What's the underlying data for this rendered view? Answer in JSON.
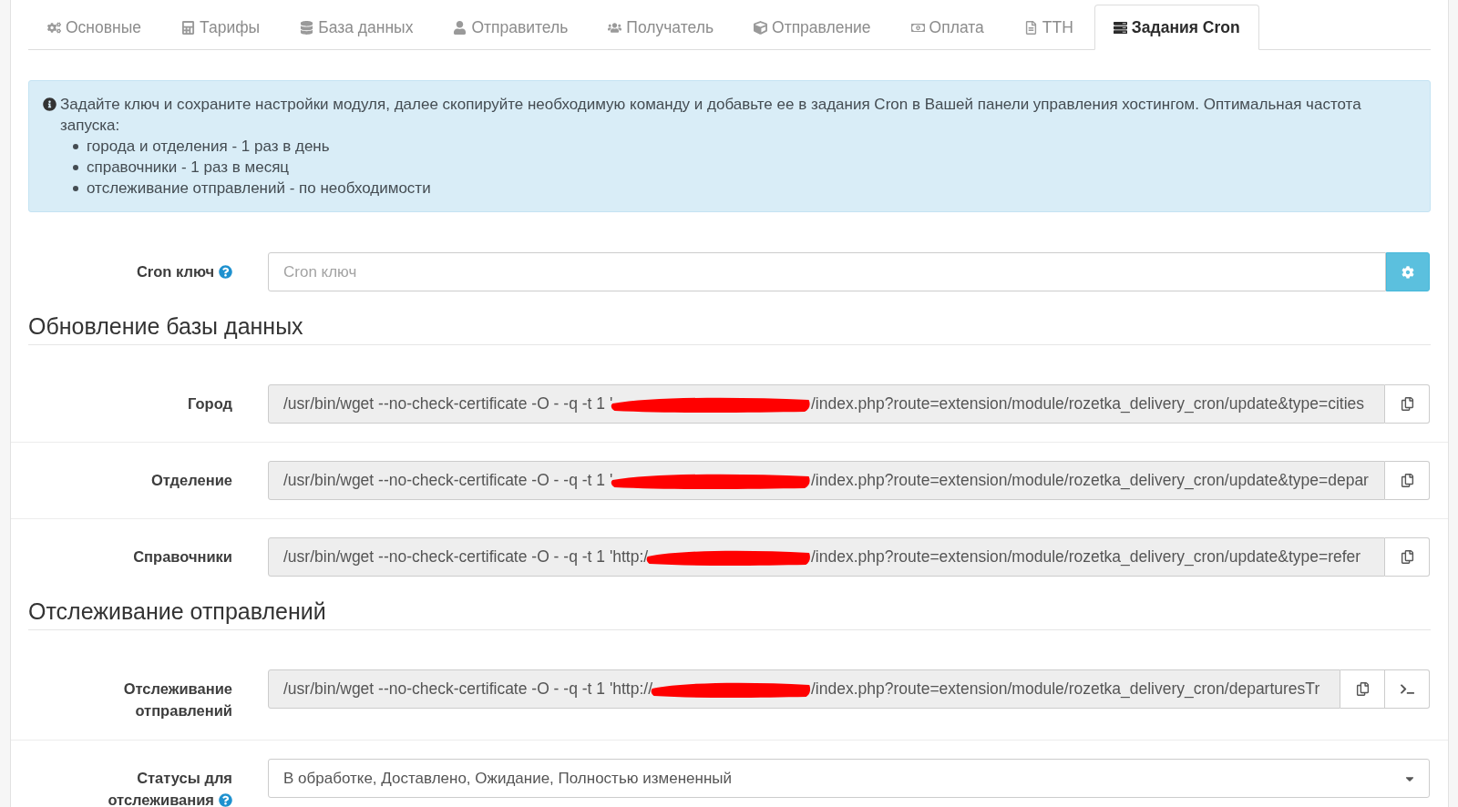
{
  "tabs": [
    {
      "label": "Основные",
      "selected": false
    },
    {
      "label": "Тарифы",
      "selected": false
    },
    {
      "label": "База данных",
      "selected": false
    },
    {
      "label": "Отправитель",
      "selected": false
    },
    {
      "label": "Получатель",
      "selected": false
    },
    {
      "label": "Отправление",
      "selected": false
    },
    {
      "label": "Оплата",
      "selected": false
    },
    {
      "label": "ТТН",
      "selected": false
    },
    {
      "label": "Задания Cron",
      "selected": true
    }
  ],
  "alert": {
    "text": "Задайте ключ и сохраните настройки модуля, далее скопируйте необходимую команду и добавьте ее в задания Cron в Вашей панели управления хостингом. Оптимальная частота запуска:",
    "items": [
      "города и отделения - 1 раз в день",
      "справочники - 1 раз в месяц",
      "отслеживание отправлений - по необходимости"
    ]
  },
  "cron_key": {
    "label": "Cron ключ",
    "help": true,
    "placeholder": "Cron ключ"
  },
  "sections": [
    {
      "title": "Обновление базы данных",
      "fields": [
        {
          "kind": "command",
          "label": "Город",
          "help": false,
          "command_start": "/usr/bin/wget --no-check-certificate -O - -q -t 1 '",
          "redacted": true,
          "command_end": "/index.php?route=extension/module/rozetka_delivery_cron/update&type=cities",
          "actions": [
            {
              "kind": "copy"
            }
          ]
        },
        {
          "kind": "command",
          "label": "Отделение",
          "help": false,
          "command_start": "/usr/bin/wget --no-check-certificate -O - -q -t 1 '",
          "redacted": true,
          "command_end": "/index.php?route=extension/module/rozetka_delivery_cron/update&type=depar",
          "actions": [
            {
              "kind": "copy"
            }
          ]
        },
        {
          "kind": "command",
          "label": "Справочники",
          "help": false,
          "command_start": "/usr/bin/wget --no-check-certificate -O - -q -t 1 'http:/",
          "redacted": true,
          "command_end": "/index.php?route=extension/module/rozetka_delivery_cron/update&type=refer",
          "actions": [
            {
              "kind": "copy"
            }
          ]
        }
      ]
    },
    {
      "title": "Отслеживание отправлений",
      "fields": [
        {
          "kind": "command",
          "label": "Отслеживание отправлений",
          "help": false,
          "command_start": "/usr/bin/wget --no-check-certificate -O - -q -t 1 'http://",
          "redacted": true,
          "command_end": "/index.php?route=extension/module/rozetka_delivery_cron/departuresTr",
          "actions": [
            {
              "kind": "copy"
            },
            {
              "kind": "terminal"
            }
          ]
        },
        {
          "kind": "select",
          "label": "Статусы для отслеживания",
          "help": true,
          "value": "В обработке, Доставлено, Ожидание, Полностью измененный"
        }
      ]
    }
  ]
}
